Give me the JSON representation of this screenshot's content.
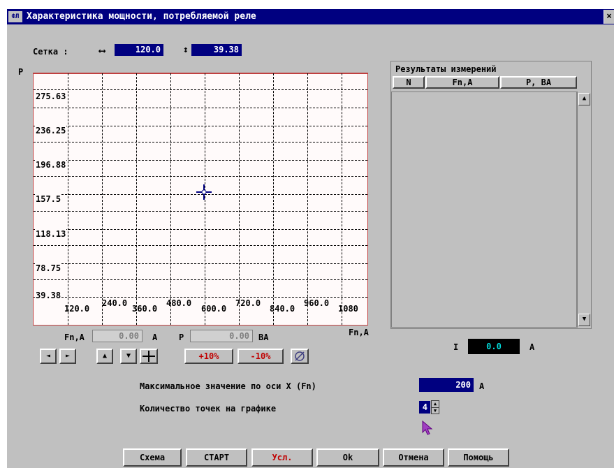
{
  "window": {
    "title": "Характеристика мощности, потребляемой реле",
    "icon": "app-icon",
    "close": "×"
  },
  "grid": {
    "label": "Сетка :",
    "x_step": "120.0",
    "y_step": "39.38"
  },
  "plot": {
    "y_axis_name": "P",
    "x_axis_name": "Fn,A",
    "y_ticks": [
      "275.63",
      "236.25",
      "196.88",
      "157.5",
      "118.13",
      "78.75",
      "39.38"
    ],
    "x_ticks": [
      "120.0",
      "240.0",
      "360.0",
      "480.0",
      "600.0",
      "720.0",
      "840.0",
      "960.0",
      "1080"
    ]
  },
  "readout": {
    "fn_label": "Fn,A",
    "fn_value": "0.00",
    "fn_unit": "A",
    "p_label": "P",
    "p_value": "0.00",
    "p_unit": "BA"
  },
  "nav_buttons": {
    "left": "◄",
    "right": "►",
    "up": "▲",
    "down": "▼",
    "plus10": "+10%",
    "minus10": "-10%"
  },
  "results": {
    "title": "Результаты измерений",
    "columns": [
      "N",
      "Fn,A",
      "P, BA"
    ],
    "rows": []
  },
  "current": {
    "label": "I",
    "value": "0.0",
    "unit": "A"
  },
  "settings": {
    "max_x_label": "Максимальное значение по оси X (Fn)",
    "max_x_value": "200",
    "max_x_unit": "A",
    "points_label": "Количество точек на графике",
    "points_value": "4"
  },
  "bottom_buttons": [
    "Схема",
    "СТАРТ",
    "Усл.",
    "Ok",
    "Отмена",
    "Помощь"
  ],
  "colors": {
    "title_bar": "#000080",
    "window": "#c0c0c0",
    "plot_bg": "#fffafa",
    "axis_red": "#c04040",
    "hotkey_red": "#c00000"
  }
}
